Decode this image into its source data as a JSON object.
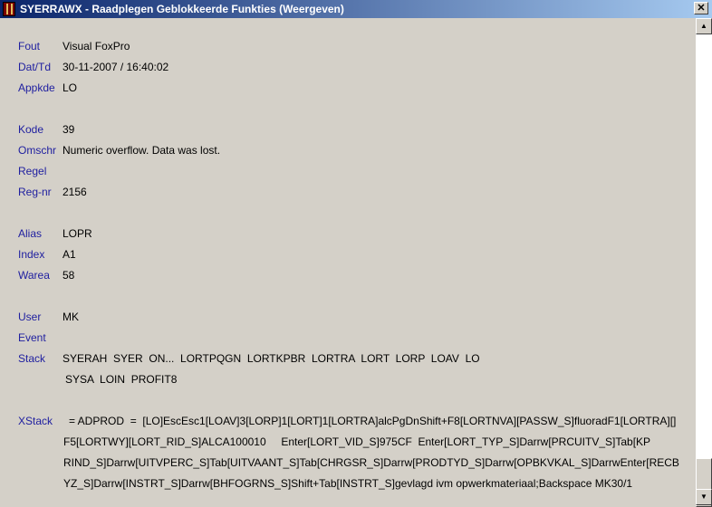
{
  "window": {
    "title": "SYERRAWX - Raadplegen Geblokkeerde Funkties (Weergeven)",
    "close_glyph": "✕"
  },
  "fields": {
    "fout": {
      "label": "Fout",
      "value": "Visual FoxPro"
    },
    "dattd": {
      "label": "Dat/Td",
      "value": "30-11-2007 / 16:40:02"
    },
    "appkde": {
      "label": "Appkde",
      "value": "LO"
    },
    "kode": {
      "label": "Kode",
      "value": "39"
    },
    "omschr": {
      "label": "Omschr",
      "value": "Numeric overflow. Data was lost."
    },
    "regel": {
      "label": "Regel",
      "value": ""
    },
    "regnr": {
      "label": "Reg-nr",
      "value": "2156"
    },
    "alias": {
      "label": "Alias",
      "value": "LOPR"
    },
    "index": {
      "label": "Index",
      "value": "A1"
    },
    "warea": {
      "label": "Warea",
      "value": "58"
    },
    "user": {
      "label": "User",
      "value": "MK"
    },
    "event": {
      "label": "Event",
      "value": ""
    },
    "stack": {
      "label": "Stack",
      "lines": [
        "SYERAH  SYER  ON...  LORTPQGN  LORTKPBR  LORTRA  LORT  LORP  LOAV  LO",
        "SYSA  LOIN  PROFIT8"
      ]
    },
    "xstack": {
      "label": "XStack",
      "lines": [
        "= ADPROD  =  [LO]EscEsc1[LOAV]3[LORP]1[LORT]1[LORTRA]alcPgDnShift+F8[LORTNVA][PASSW_S]fluoradF1[LORTRA][]",
        "F5[LORTWY][LORT_RID_S]ALCA100010     Enter[LORT_VID_S]975CF  Enter[LORT_TYP_S]Darrw[PRCUITV_S]Tab[KP",
        "RIND_S]Darrw[UITVPERC_S]Tab[UITVAANT_S]Tab[CHRGSR_S]Darrw[PRODTYD_S]Darrw[OPBKVKAL_S]DarrwEnter[RECB",
        "YZ_S]Darrw[INSTRT_S]Darrw[BHFOGRNS_S]Shift+Tab[INSTRT_S]gevlagd ivm opwerkmateriaal;Backspace MK30/1"
      ]
    }
  },
  "scrollbar": {
    "up_glyph": "▲",
    "down_glyph": "▼"
  },
  "colors": {
    "label": "#2020a0",
    "title_bar": "#0a246a",
    "background": "#d4d0c8"
  }
}
